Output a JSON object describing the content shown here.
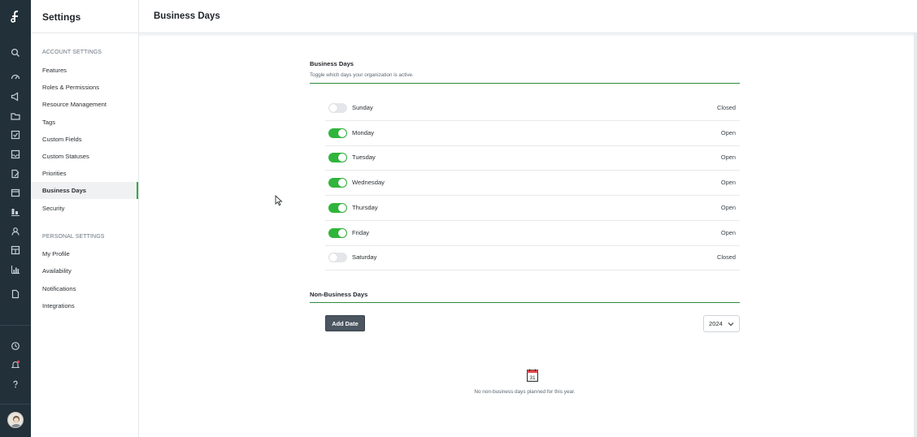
{
  "sidebar": {
    "title": "Settings",
    "account_section": "ACCOUNT SETTINGS",
    "account_items": [
      "Features",
      "Roles & Permissions",
      "Resource Management",
      "Tags",
      "Custom Fields",
      "Custom Statuses",
      "Priorities",
      "Business Days",
      "Security"
    ],
    "personal_section": "PERSONAL SETTINGS",
    "personal_items": [
      "My Profile",
      "Availability",
      "Notifications",
      "Integrations"
    ],
    "active_item": "Business Days"
  },
  "header": {
    "title": "Business Days"
  },
  "business_days": {
    "heading": "Business Days",
    "subtitle": "Toggle which days your organization is active.",
    "days": [
      {
        "name": "Sunday",
        "enabled": false,
        "status": "Closed"
      },
      {
        "name": "Monday",
        "enabled": true,
        "status": "Open"
      },
      {
        "name": "Tuesday",
        "enabled": true,
        "status": "Open"
      },
      {
        "name": "Wednesday",
        "enabled": true,
        "status": "Open"
      },
      {
        "name": "Thursday",
        "enabled": true,
        "status": "Open"
      },
      {
        "name": "Friday",
        "enabled": true,
        "status": "Open"
      },
      {
        "name": "Saturday",
        "enabled": false,
        "status": "Closed"
      }
    ]
  },
  "non_business_days": {
    "heading": "Non-Business Days",
    "add_button": "Add Date",
    "year": "2024",
    "calendar_day": "31",
    "empty_message": "No non-business days planned for this year."
  },
  "rail_icons": [
    "search-icon",
    "dashboard-icon",
    "megaphone-icon",
    "folder-icon",
    "checkbox-icon",
    "inbox-icon",
    "document-edit-icon",
    "calendar-icon",
    "board-icon",
    "user-icon",
    "layout-icon",
    "bar-chart-icon",
    "file-icon",
    "clock-icon",
    "bell-icon",
    "help-icon"
  ],
  "colors": {
    "accent": "#2fb53b",
    "rail": "#22303a",
    "button": "#4b5661"
  }
}
